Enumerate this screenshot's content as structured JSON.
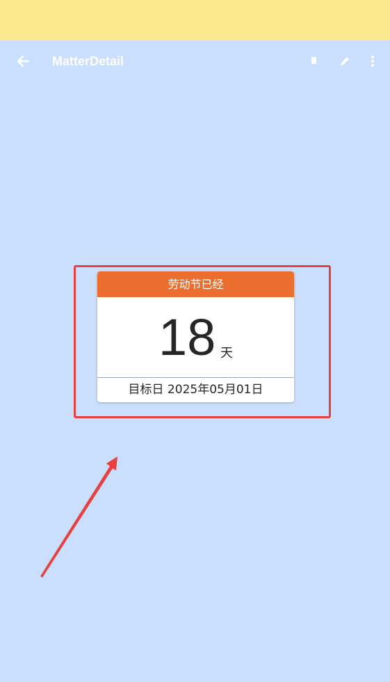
{
  "app_bar": {
    "title": "MatterDetail",
    "icons": {
      "back": "arrow-back-icon",
      "delete": "delete-icon",
      "edit": "edit-pencil-icon",
      "more": "more-vertical-icon"
    }
  },
  "card": {
    "header": "劳动节已经",
    "days": "18",
    "unit": "天",
    "footer": "目标日 2025年05月01日"
  },
  "colors": {
    "background": "#cadffd",
    "status_bar": "#fbe88e",
    "header_accent": "#eb7030",
    "annotation": "#e8403f"
  }
}
